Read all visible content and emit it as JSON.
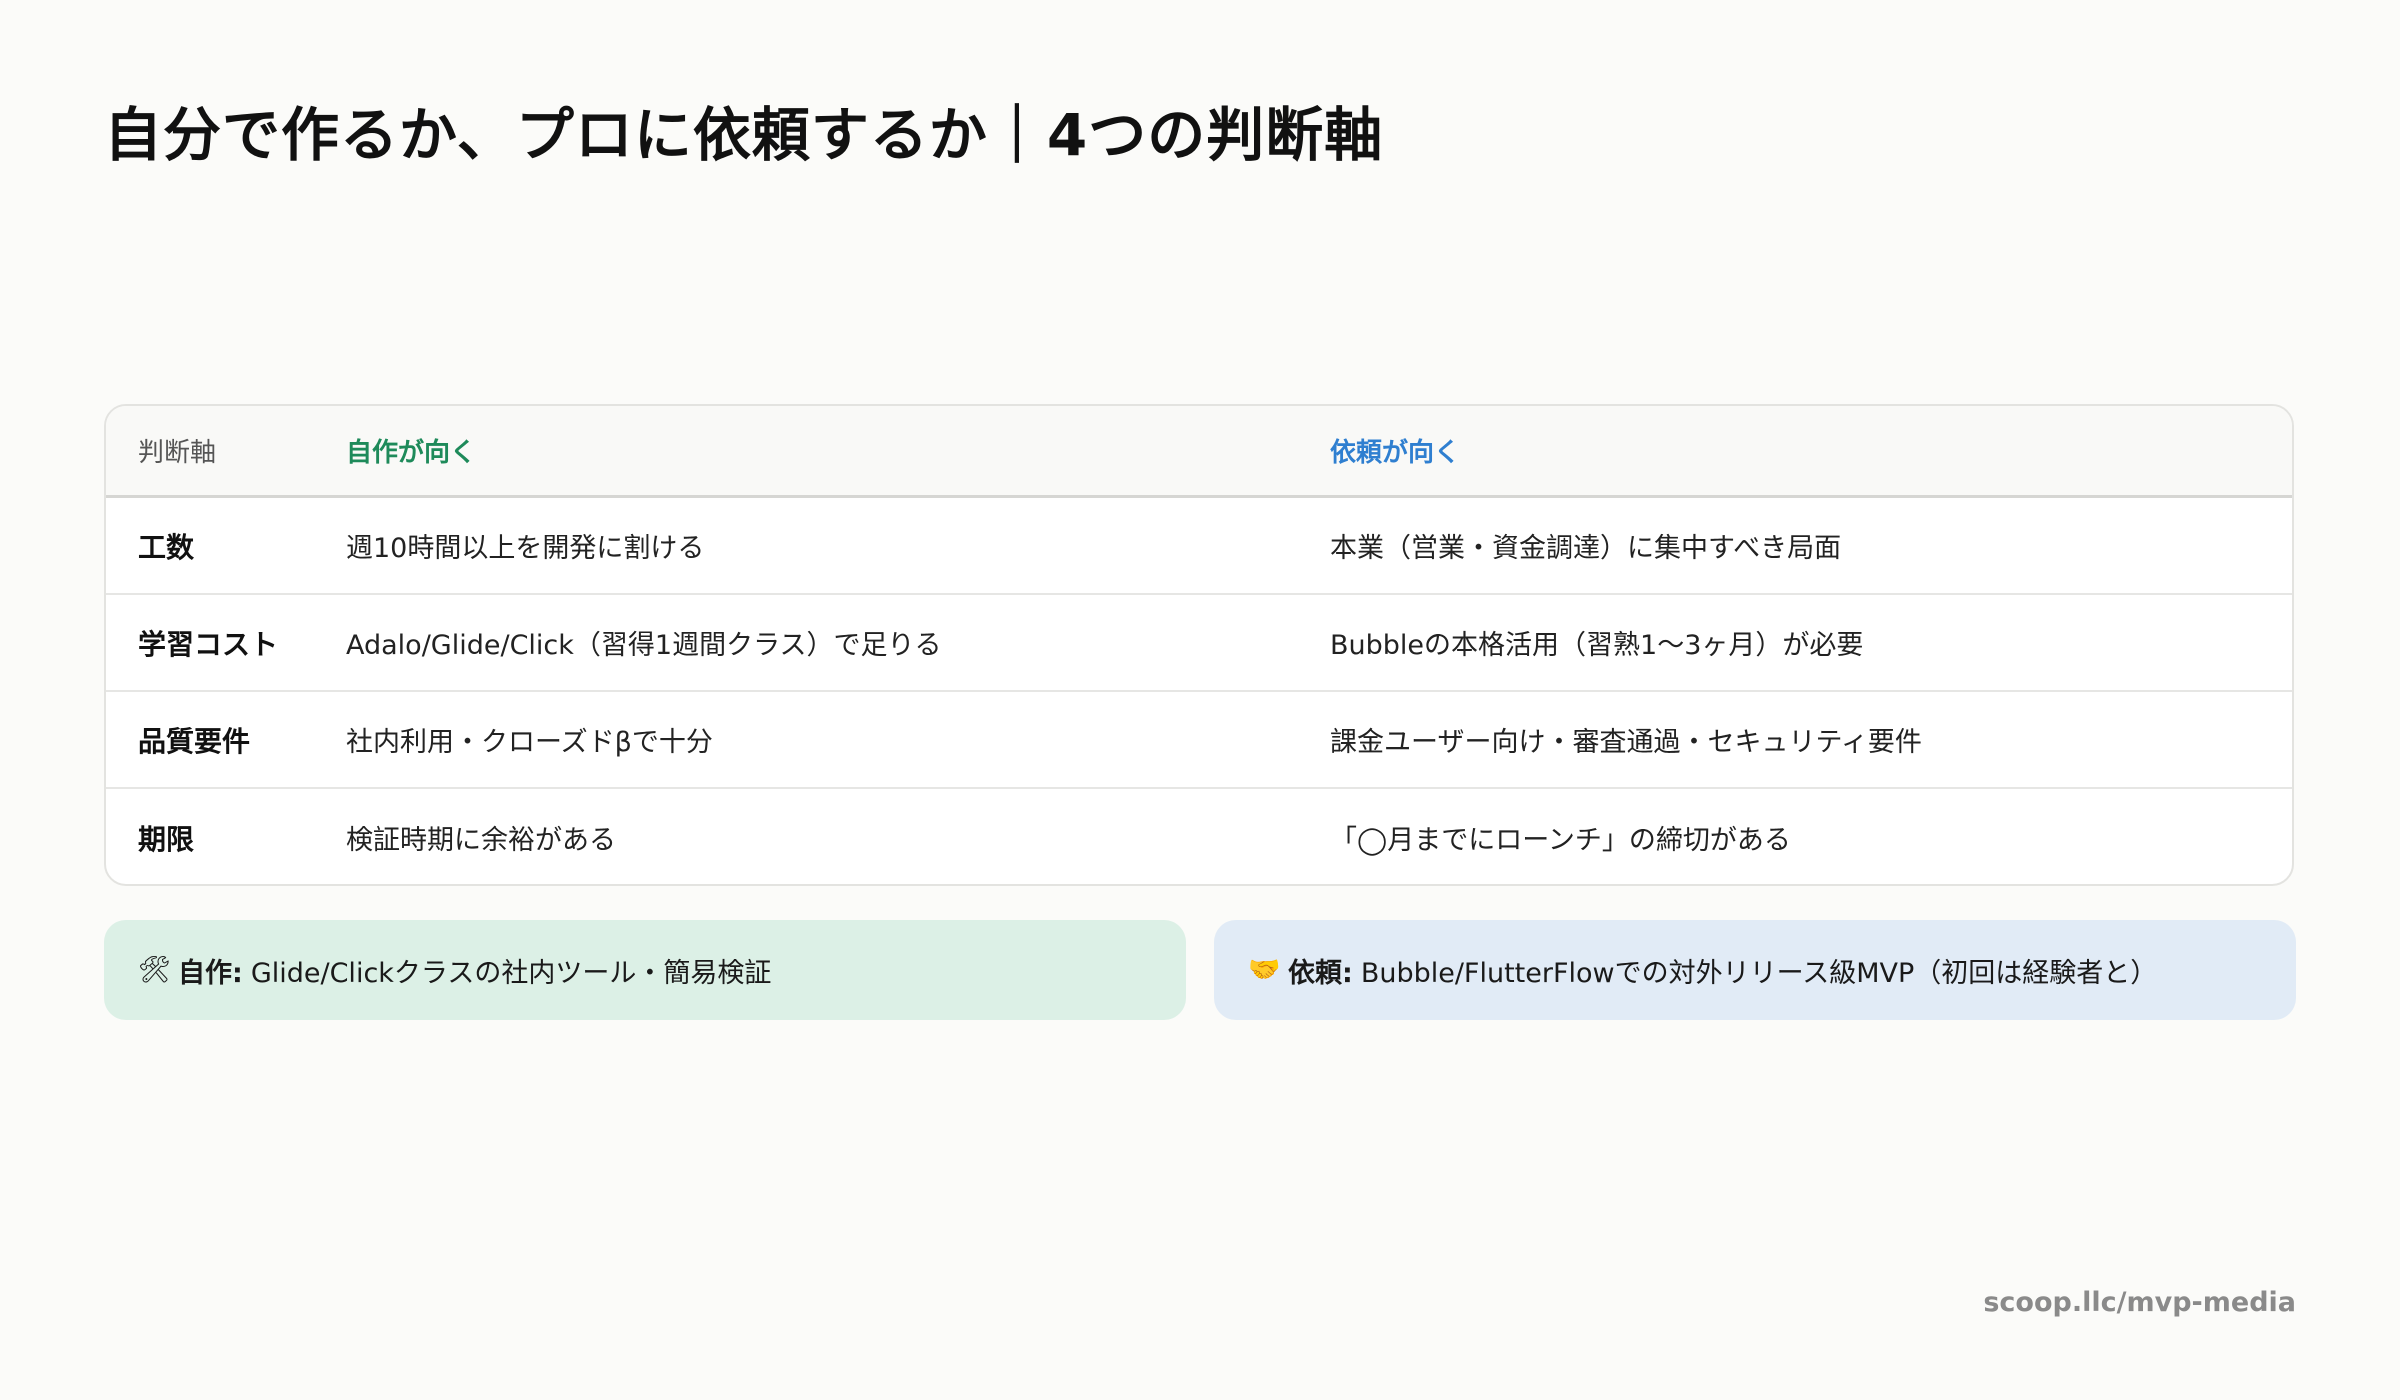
{
  "title": "自分で作るか、プロに依頼するか｜4つの判断軸",
  "table": {
    "headers": {
      "axis": "判断軸",
      "self": "自作が向く",
      "request": "依頼が向く"
    },
    "rows": [
      {
        "axis": "工数",
        "self": "週10時間以上を開発に割ける",
        "request": "本業（営業・資金調達）に集中すべき局面"
      },
      {
        "axis": "学習コスト",
        "self": "Adalo/Glide/Click（習得1週間クラス）で足りる",
        "request": "Bubbleの本格活用（習熟1〜3ヶ月）が必要"
      },
      {
        "axis": "品質要件",
        "self": "社内利用・クローズドβで十分",
        "request": "課金ユーザー向け・審査通過・セキュリティ要件"
      },
      {
        "axis": "期限",
        "self": "検証時期に余裕がある",
        "request": "「◯月までにローンチ」の締切がある"
      }
    ]
  },
  "callouts": {
    "self": {
      "icon": "🛠",
      "icon_name": "tools-icon",
      "label": "自作:",
      "text": "Glide/Clickクラスの社内ツール・簡易検証"
    },
    "request": {
      "icon": "🤝",
      "icon_name": "handshake-icon",
      "label": "依頼:",
      "text": "Bubble/FlutterFlowでの対外リリース級MVP（初回は経験者と）"
    }
  },
  "footer": "scoop.llc/mvp-media",
  "colors": {
    "self_accent": "#1e8a5a",
    "request_accent": "#2f7fd0",
    "self_bg": "#dcf0e6",
    "request_bg": "#e1ebf6"
  }
}
